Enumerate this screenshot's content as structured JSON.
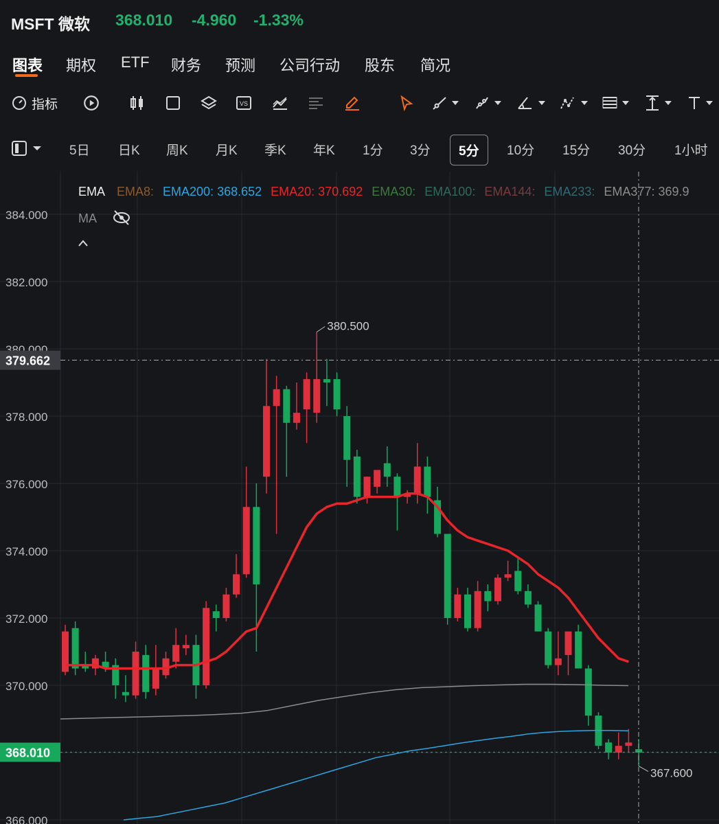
{
  "header": {
    "name": "MSFT 微软",
    "price": "368.010",
    "change": "-4.960",
    "change_pct": "-1.33%",
    "color": "#20b26c"
  },
  "tabs": [
    {
      "label": "图表",
      "active": true
    },
    {
      "label": "期权"
    },
    {
      "label": "ETF"
    },
    {
      "label": "财务"
    },
    {
      "label": "预测"
    },
    {
      "label": "公司行动"
    },
    {
      "label": "股东"
    },
    {
      "label": "简况"
    }
  ],
  "toolbar": {
    "indicators_label": "指标",
    "icons": [
      "gauge-icon",
      "replay-icon",
      "candlestick-icon",
      "square-icon",
      "layers-icon",
      "compare-icon",
      "chart-line-icon",
      "text-lines-icon",
      "pencil-icon",
      "cursor-icon",
      "trendline-icon",
      "brush-icon",
      "angle-icon",
      "pattern-icon",
      "fib-icon",
      "price-range-icon",
      "text-icon"
    ],
    "accent": "#f26b1d"
  },
  "periods": [
    "5日",
    "日K",
    "周K",
    "月K",
    "季K",
    "年K",
    "1分",
    "3分",
    "5分",
    "10分",
    "15分",
    "30分",
    "1小时"
  ],
  "active_period": "5分",
  "legend": {
    "title": "EMA",
    "items": [
      {
        "name": "EMA8:",
        "value": "",
        "color": "#8a5a2f"
      },
      {
        "name": "EMA200:",
        "value": "368.652",
        "color": "#2aa7e2"
      },
      {
        "name": "EMA20:",
        "value": "370.692",
        "color": "#e8262a"
      },
      {
        "name": "EMA30:",
        "value": "",
        "color": "#3d7a3f"
      },
      {
        "name": "EMA100:",
        "value": "",
        "color": "#2f6a5c"
      },
      {
        "name": "EMA144:",
        "value": "",
        "color": "#7a3a3d"
      },
      {
        "name": "EMA233:",
        "value": "",
        "color": "#2f6a72"
      },
      {
        "name": "EMA377:",
        "value": "369.9",
        "color": "#8c8c8c"
      }
    ],
    "ma_label": "MA"
  },
  "chart_data": {
    "type": "candlestick",
    "y_ticks": [
      "384.000",
      "382.000",
      "380.000",
      "378.000",
      "376.000",
      "374.000",
      "372.000",
      "370.000",
      "368.000",
      "366.000"
    ],
    "ylim": [
      366,
      385
    ],
    "annotations": {
      "high": "380.500",
      "low": "367.600",
      "crosshair_price": "379.662",
      "last_price": "368.010"
    },
    "candles": [
      {
        "o": 370.4,
        "h": 371.8,
        "l": 370.3,
        "c": 371.6
      },
      {
        "o": 371.7,
        "h": 371.9,
        "l": 370.3,
        "c": 370.5
      },
      {
        "o": 370.6,
        "h": 371.0,
        "l": 370.4,
        "c": 370.5
      },
      {
        "o": 370.5,
        "h": 370.9,
        "l": 370.3,
        "c": 370.8
      },
      {
        "o": 370.7,
        "h": 371.0,
        "l": 370.4,
        "c": 370.5
      },
      {
        "o": 370.6,
        "h": 370.8,
        "l": 369.6,
        "c": 370.0
      },
      {
        "o": 369.8,
        "h": 370.3,
        "l": 369.5,
        "c": 369.7
      },
      {
        "o": 369.7,
        "h": 371.3,
        "l": 369.6,
        "c": 371.0
      },
      {
        "o": 370.9,
        "h": 371.2,
        "l": 369.6,
        "c": 369.8
      },
      {
        "o": 369.9,
        "h": 371.2,
        "l": 369.7,
        "c": 370.5
      },
      {
        "o": 370.3,
        "h": 371.0,
        "l": 370.2,
        "c": 370.8
      },
      {
        "o": 370.7,
        "h": 371.7,
        "l": 370.5,
        "c": 371.2
      },
      {
        "o": 371.1,
        "h": 371.5,
        "l": 370.9,
        "c": 371.2
      },
      {
        "o": 371.2,
        "h": 371.5,
        "l": 369.6,
        "c": 370.0
      },
      {
        "o": 370.0,
        "h": 372.5,
        "l": 369.9,
        "c": 372.3
      },
      {
        "o": 372.2,
        "h": 372.4,
        "l": 371.6,
        "c": 372.0
      },
      {
        "o": 372.0,
        "h": 372.9,
        "l": 371.9,
        "c": 372.7
      },
      {
        "o": 372.7,
        "h": 373.9,
        "l": 372.6,
        "c": 373.3
      },
      {
        "o": 373.3,
        "h": 376.5,
        "l": 373.2,
        "c": 375.3
      },
      {
        "o": 375.3,
        "h": 376.0,
        "l": 371.0,
        "c": 373.0
      },
      {
        "o": 376.2,
        "h": 379.7,
        "l": 375.7,
        "c": 378.3
      },
      {
        "o": 378.3,
        "h": 379.2,
        "l": 374.5,
        "c": 378.8
      },
      {
        "o": 378.8,
        "h": 378.9,
        "l": 376.2,
        "c": 377.8
      },
      {
        "o": 377.8,
        "h": 379.0,
        "l": 377.6,
        "c": 378.1
      },
      {
        "o": 378.2,
        "h": 379.3,
        "l": 377.2,
        "c": 379.1
      },
      {
        "o": 378.1,
        "h": 380.5,
        "l": 377.8,
        "c": 379.1
      },
      {
        "o": 379.1,
        "h": 379.7,
        "l": 378.3,
        "c": 379.0
      },
      {
        "o": 379.1,
        "h": 379.3,
        "l": 378.0,
        "c": 378.2
      },
      {
        "o": 378.0,
        "h": 378.3,
        "l": 375.9,
        "c": 376.7
      },
      {
        "o": 376.8,
        "h": 377.0,
        "l": 375.4,
        "c": 375.6
      },
      {
        "o": 375.6,
        "h": 376.2,
        "l": 375.4,
        "c": 376.2
      },
      {
        "o": 375.9,
        "h": 376.3,
        "l": 375.7,
        "c": 376.4
      },
      {
        "o": 376.6,
        "h": 377.1,
        "l": 375.9,
        "c": 376.2
      },
      {
        "o": 376.2,
        "h": 376.3,
        "l": 374.6,
        "c": 375.6
      },
      {
        "o": 375.6,
        "h": 375.8,
        "l": 375.4,
        "c": 375.7
      },
      {
        "o": 375.7,
        "h": 377.2,
        "l": 375.4,
        "c": 376.5
      },
      {
        "o": 376.5,
        "h": 376.8,
        "l": 375.1,
        "c": 375.6
      },
      {
        "o": 375.5,
        "h": 375.9,
        "l": 374.4,
        "c": 374.5
      },
      {
        "o": 374.5,
        "h": 374.5,
        "l": 371.8,
        "c": 372.0
      },
      {
        "o": 372.0,
        "h": 372.9,
        "l": 371.9,
        "c": 372.7
      },
      {
        "o": 372.7,
        "h": 372.9,
        "l": 371.6,
        "c": 371.7
      },
      {
        "o": 371.7,
        "h": 373.1,
        "l": 371.6,
        "c": 372.8
      },
      {
        "o": 372.8,
        "h": 373.0,
        "l": 372.2,
        "c": 372.5
      },
      {
        "o": 372.5,
        "h": 373.3,
        "l": 372.4,
        "c": 373.2
      },
      {
        "o": 373.2,
        "h": 373.7,
        "l": 373.1,
        "c": 373.3
      },
      {
        "o": 373.4,
        "h": 373.8,
        "l": 372.7,
        "c": 372.8
      },
      {
        "o": 372.8,
        "h": 373.0,
        "l": 372.3,
        "c": 372.4
      },
      {
        "o": 372.4,
        "h": 372.5,
        "l": 371.6,
        "c": 371.6
      },
      {
        "o": 371.6,
        "h": 371.7,
        "l": 370.5,
        "c": 370.6
      },
      {
        "o": 370.6,
        "h": 371.6,
        "l": 370.3,
        "c": 370.8
      },
      {
        "o": 370.9,
        "h": 371.6,
        "l": 370.3,
        "c": 371.6
      },
      {
        "o": 371.6,
        "h": 371.8,
        "l": 370.5,
        "c": 370.5
      },
      {
        "o": 370.5,
        "h": 370.6,
        "l": 368.8,
        "c": 369.1
      },
      {
        "o": 369.1,
        "h": 369.2,
        "l": 368.1,
        "c": 368.2
      },
      {
        "o": 368.3,
        "h": 368.4,
        "l": 367.8,
        "c": 368.0
      },
      {
        "o": 368.0,
        "h": 368.6,
        "l": 367.8,
        "c": 368.2
      },
      {
        "o": 368.2,
        "h": 368.7,
        "l": 368.0,
        "c": 368.3
      },
      {
        "o": 368.1,
        "h": 368.4,
        "l": 367.6,
        "c": 368.0
      }
    ],
    "ema20": [
      370.6,
      370.6,
      370.6,
      370.6,
      370.5,
      370.5,
      370.5,
      370.5,
      370.5,
      370.5,
      370.5,
      370.6,
      370.6,
      370.6,
      370.7,
      370.8,
      371.0,
      371.3,
      371.6,
      371.7,
      372.3,
      372.9,
      373.5,
      374.1,
      374.7,
      375.1,
      375.3,
      375.4,
      375.4,
      375.5,
      375.6,
      375.6,
      375.6,
      375.6,
      375.7,
      375.7,
      375.6,
      375.3,
      374.9,
      374.6,
      374.4,
      374.3,
      374.2,
      374.1,
      374.0,
      373.8,
      373.6,
      373.3,
      373.1,
      372.9,
      372.6,
      372.2,
      371.8,
      371.4,
      371.1,
      370.8,
      370.7
    ],
    "ema200": [
      366.0,
      366.05,
      366.1,
      366.2,
      366.3,
      366.4,
      366.5,
      366.65,
      366.8,
      366.95,
      367.1,
      367.25,
      367.4,
      367.55,
      367.7,
      367.85,
      367.95,
      368.05,
      368.12,
      368.2,
      368.28,
      368.35,
      368.42,
      368.48,
      368.55,
      368.6,
      368.63,
      368.65,
      368.66,
      368.66,
      368.65
    ],
    "ema377": [
      369.0,
      369.02,
      369.04,
      369.06,
      369.08,
      369.1,
      369.13,
      369.17,
      369.25,
      369.4,
      369.55,
      369.67,
      369.78,
      369.87,
      369.93,
      369.96,
      369.99,
      370.01,
      370.03,
      370.03,
      370.02,
      370.0,
      369.99
    ]
  },
  "colors": {
    "up": "#e0303e",
    "down": "#17a85c",
    "ema20": "#e8262a",
    "ema200": "#2aa7e2",
    "ema377": "#8c8c8c",
    "grid": "#272a33",
    "axis_text": "#bdbdbd",
    "price_tag": "#17a85c"
  }
}
